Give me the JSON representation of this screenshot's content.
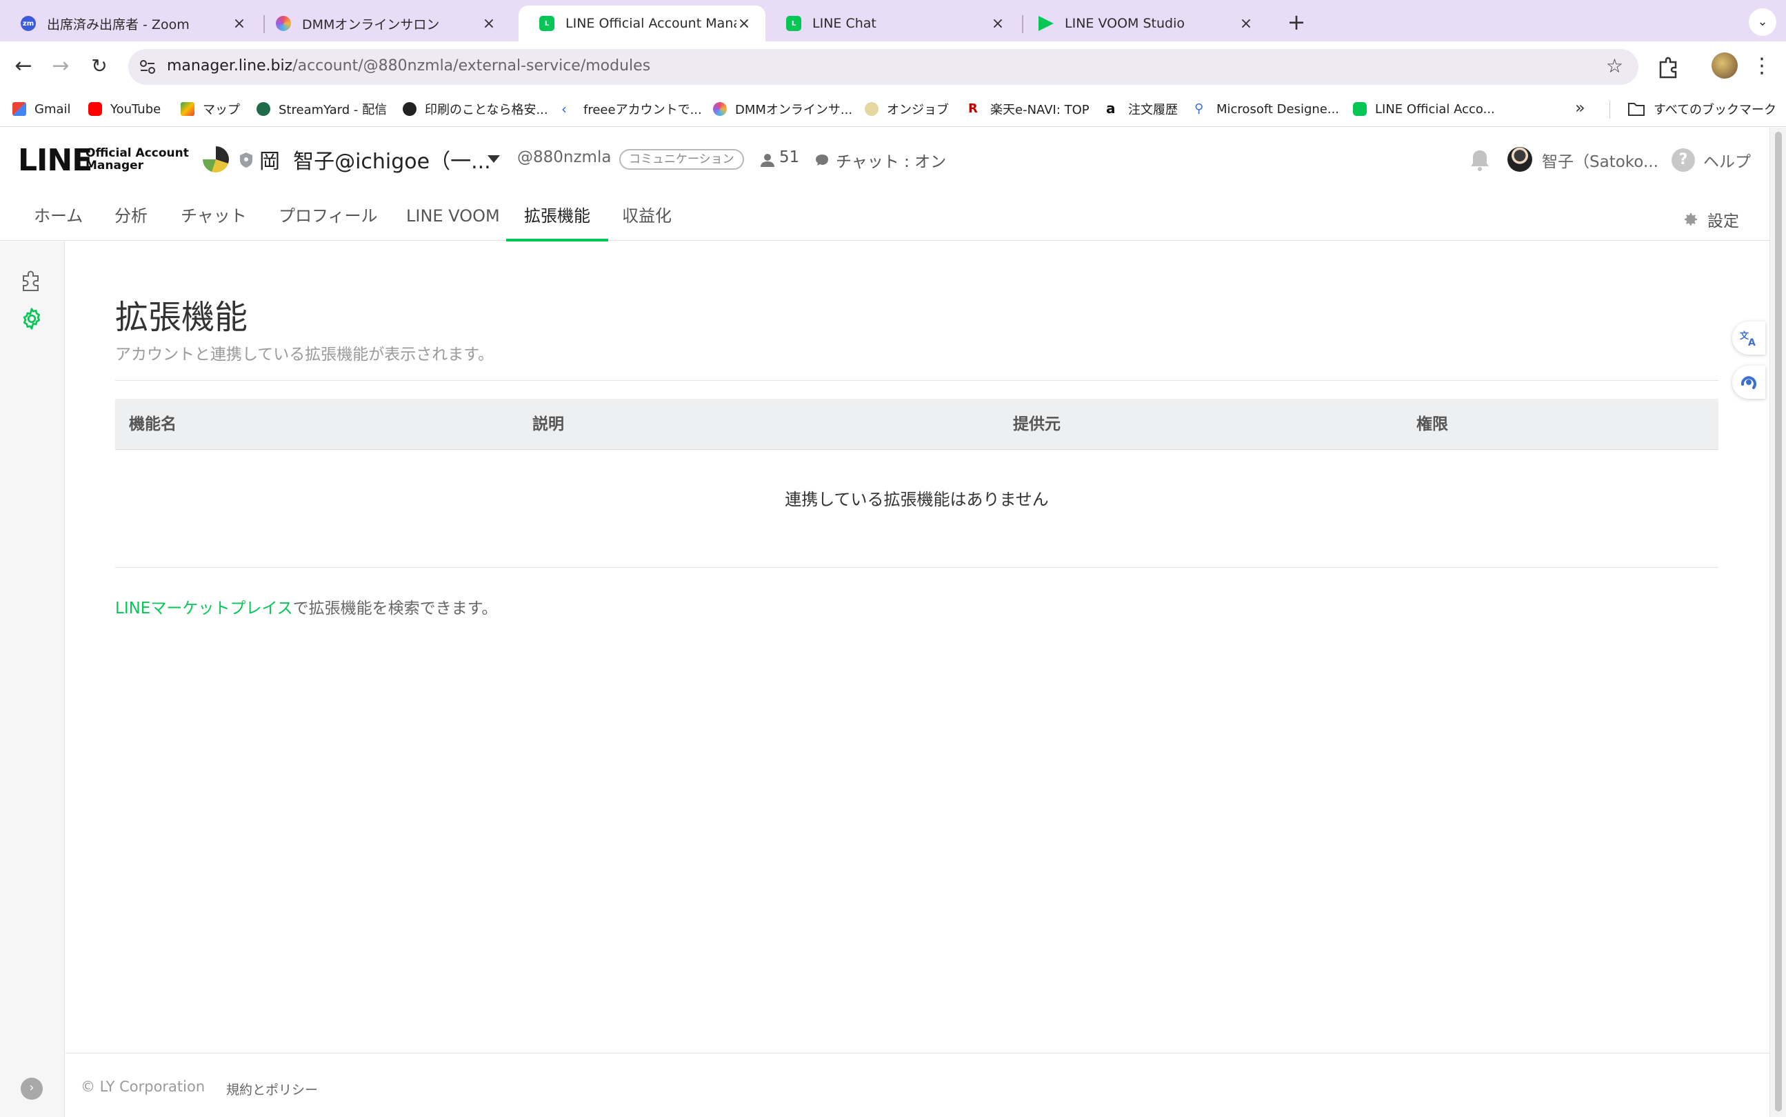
{
  "browser": {
    "tabs": [
      {
        "title": "出席済み出席者 - Zoom",
        "favicon": "zoom-icon",
        "active": false
      },
      {
        "title": "DMMオンラインサロン",
        "favicon": "dmm-icon",
        "active": false
      },
      {
        "title": "LINE Official Account Manage",
        "favicon": "line-oa-icon",
        "active": true
      },
      {
        "title": "LINE Chat",
        "favicon": "line-oa-icon",
        "active": false
      },
      {
        "title": "LINE VOOM Studio",
        "favicon": "line-voom-icon",
        "active": false
      }
    ],
    "url_host": "manager.line.biz",
    "url_path": "/account/@880nzmla/external-service/modules",
    "bookmarks": [
      {
        "label": "Gmail",
        "icon": "gmail-icon"
      },
      {
        "label": "YouTube",
        "icon": "youtube-icon"
      },
      {
        "label": "マップ",
        "icon": "maps-icon"
      },
      {
        "label": "StreamYard - 配信",
        "icon": "streamyard-icon"
      },
      {
        "label": "印刷のことなら格安...",
        "icon": "print-icon"
      },
      {
        "label": "freeeアカウントで...",
        "icon": "freee-icon"
      },
      {
        "label": "DMMオンラインサ...",
        "icon": "dmm-icon"
      },
      {
        "label": "オンジョブ",
        "icon": "onjob-icon"
      },
      {
        "label": "楽天e-NAVI: TOP",
        "icon": "rakuten-icon"
      },
      {
        "label": "注文履歴",
        "icon": "amazon-icon"
      },
      {
        "label": "Microsoft Designe...",
        "icon": "search-icon"
      },
      {
        "label": "LINE Official Acco...",
        "icon": "line-oa-icon"
      }
    ],
    "all_bookmarks_label": "すべてのブックマーク"
  },
  "header": {
    "logo_text": "LINE",
    "logo_sub_1": "Official Account",
    "logo_sub_2": "Manager",
    "account_initial": "岡",
    "account_name": "智子@ichigoe（一...",
    "account_id": "@880nzmla",
    "plan": "コミュニケーション",
    "friends": "51",
    "chat_status": "チャット : オン",
    "user_name": "智子（Satoko...",
    "help_label": "ヘルプ"
  },
  "nav": {
    "items": [
      "ホーム",
      "分析",
      "チャット",
      "プロフィール",
      "LINE VOOM",
      "拡張機能",
      "収益化"
    ],
    "active_index": 5,
    "settings_label": "設定"
  },
  "content": {
    "title": "拡張機能",
    "description": "アカウントと連携している拡張機能が表示されます。",
    "table": {
      "columns": [
        "機能名",
        "説明",
        "提供元",
        "権限"
      ],
      "empty_message": "連携している拡張機能はありません"
    },
    "marketplace_link": "LINEマーケットプレイス",
    "marketplace_suffix": "で拡張機能を検索できます。"
  },
  "footer": {
    "copyright": "© LY Corporation",
    "policy": "規約とポリシー"
  },
  "colors": {
    "accent": "#06c755",
    "tabstrip": "#e9dcf6"
  }
}
